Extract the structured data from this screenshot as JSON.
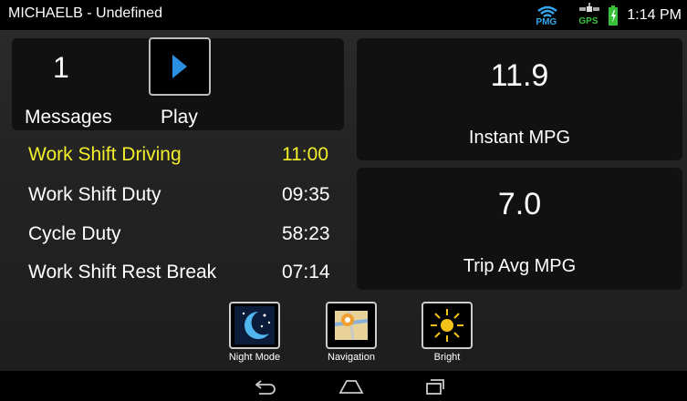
{
  "status_bar": {
    "title": "MICHAELB - Undefined",
    "pmg_label": "PMG",
    "gps_label": "GPS",
    "time": "1:14 PM",
    "icons": [
      "pmg-signal-icon",
      "gps-icon",
      "battery-icon"
    ],
    "battery_color": "#39c239"
  },
  "messages": {
    "count": "1",
    "label": "Messages",
    "play_label": "Play",
    "play_color": "#2a8fe0"
  },
  "timers": [
    {
      "label": "Work Shift Driving",
      "value": "11:00",
      "highlight": true
    },
    {
      "label": "Work Shift Duty",
      "value": "09:35",
      "highlight": false
    },
    {
      "label": "Cycle Duty",
      "value": "58:23",
      "highlight": false
    },
    {
      "label": "Work Shift Rest Break",
      "value": "07:14",
      "highlight": false
    }
  ],
  "highlight_color": "#f3ef2a",
  "mpg": {
    "instant_value": "11.9",
    "instant_label": "Instant MPG",
    "trip_value": "7.0",
    "trip_label": "Trip Avg MPG"
  },
  "tools": [
    {
      "label": "Night Mode",
      "icon": "moon-icon"
    },
    {
      "label": "Navigation",
      "icon": "map-icon"
    },
    {
      "label": "Bright",
      "icon": "sun-icon"
    }
  ],
  "nav_bar": {
    "icons": [
      "back-icon",
      "home-icon",
      "recents-icon"
    ]
  }
}
